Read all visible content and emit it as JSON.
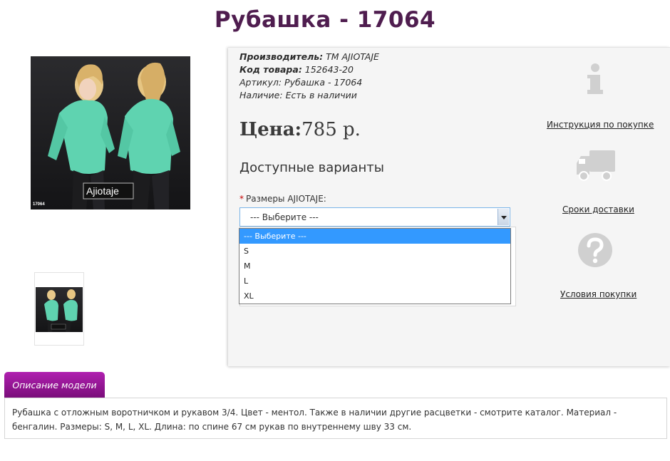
{
  "product": {
    "title": "Рубашка - 17064"
  },
  "images": {
    "main_caption_brand": "Ajiotaje",
    "main_caption_code": "17064"
  },
  "meta": {
    "manufacturer_label": "Производитель:",
    "manufacturer_value": "ТМ AJIOTAJE",
    "code_label": "Код товара:",
    "code_value": "152643-20",
    "article_label": "Артикул:",
    "article_value": "Рубашка - 17064",
    "availability_label": "Наличие:",
    "availability_value": "Есть в наличии"
  },
  "price": {
    "label": "Цена:",
    "value": "785 р."
  },
  "variants": {
    "heading": "Доступные варианты",
    "required_mark": "*",
    "size_label": "Размеры AJIOTAJE:",
    "selected": "--- Выберите ---",
    "options": [
      "--- Выберите ---",
      "S",
      "M",
      "L",
      "XL"
    ]
  },
  "side": {
    "instruction_label": "Инструкция по покупке",
    "delivery_label": "Сроки доставки",
    "terms_label": "Условия покупки"
  },
  "tabs": {
    "description_label": "Описание модели"
  },
  "description": {
    "text": "Рубашка с отложным воротничком и рукавом 3/4. Цвет - ментол. Также в наличии другие расцветки - смотрите каталог. Материал - бенгалин. Размеры: S, M, L, XL. Длина: по спине 67 см рукав по внутреннему шву 33 см."
  },
  "colors": {
    "title": "#4f1d4f",
    "tab": "#9b1a9b",
    "shirt": "#5fd3b0",
    "icon_gray": "#d0d0d0",
    "selected_option": "#3399ff"
  },
  "icons": [
    "info-icon",
    "delivery-truck-icon",
    "question-icon"
  ]
}
